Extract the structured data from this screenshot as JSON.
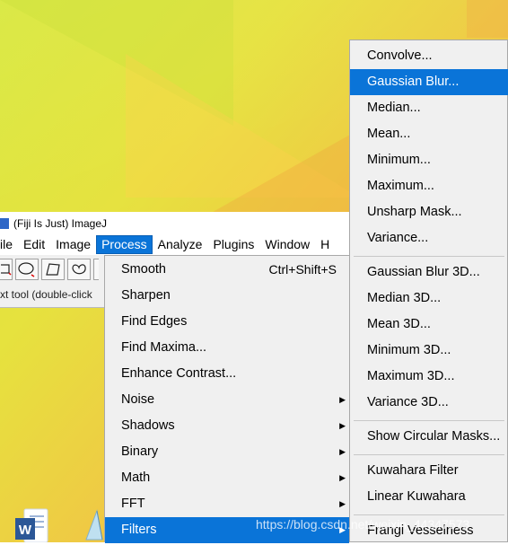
{
  "window": {
    "title": "(Fiji Is Just) ImageJ",
    "status": "xt tool (double-click"
  },
  "menubar": {
    "items": [
      "ile",
      "Edit",
      "Image",
      "Process",
      "Analyze",
      "Plugins",
      "Window",
      "H"
    ],
    "active": "Process"
  },
  "toolbar": {
    "tools": [
      "rectangle-tool-icon",
      "oval-tool-icon",
      "polygon-tool-icon",
      "freehand-tool-icon"
    ]
  },
  "process_menu": {
    "items": [
      {
        "label": "Smooth",
        "shortcut": "Ctrl+Shift+S",
        "submenu": false
      },
      {
        "label": "Sharpen",
        "shortcut": "",
        "submenu": false
      },
      {
        "label": "Find Edges",
        "shortcut": "",
        "submenu": false
      },
      {
        "label": "Find Maxima...",
        "shortcut": "",
        "submenu": false
      },
      {
        "label": "Enhance Contrast...",
        "shortcut": "",
        "submenu": false
      },
      {
        "label": "Noise",
        "shortcut": "",
        "submenu": true
      },
      {
        "label": "Shadows",
        "shortcut": "",
        "submenu": true
      },
      {
        "label": "Binary",
        "shortcut": "",
        "submenu": true
      },
      {
        "label": "Math",
        "shortcut": "",
        "submenu": true
      },
      {
        "label": "FFT",
        "shortcut": "",
        "submenu": true
      },
      {
        "label": "Filters",
        "shortcut": "",
        "submenu": true
      }
    ],
    "highlighted": "Filters",
    "arrow_glyph": "▶"
  },
  "filters_menu": {
    "group1": [
      "Convolve...",
      "Gaussian Blur...",
      "Median...",
      "Mean...",
      "Minimum...",
      "Maximum...",
      "Unsharp Mask...",
      "Variance..."
    ],
    "group2": [
      "Gaussian Blur 3D...",
      "Median 3D...",
      "Mean 3D...",
      "Minimum 3D...",
      "Maximum 3D...",
      "Variance 3D..."
    ],
    "group3": [
      "Show Circular Masks..."
    ],
    "group4": [
      "Kuwahara Filter",
      "Linear Kuwahara"
    ],
    "group5": [
      "Frangi Vesselness"
    ],
    "highlighted": "Gaussian Blur..."
  },
  "watermark": "https://blog.csdn.net/weixin_44347573",
  "colors": {
    "highlight": "#0a74d8",
    "menu_bg": "#f0f0f0"
  }
}
